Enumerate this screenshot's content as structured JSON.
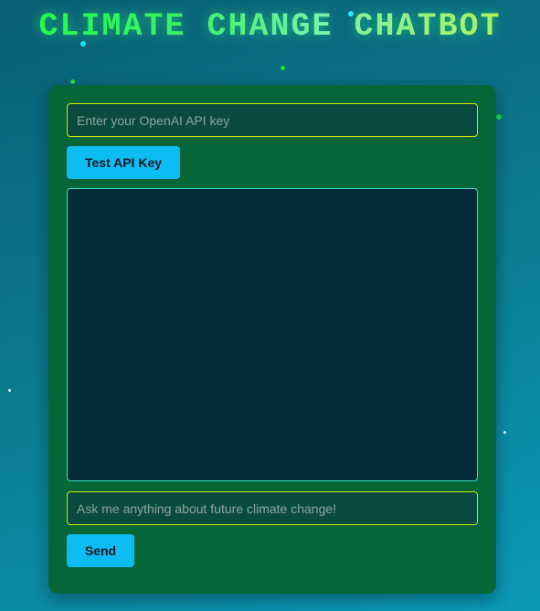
{
  "header": {
    "title": "CLIMATE CHANGE CHATBOT"
  },
  "api_key": {
    "placeholder": "Enter your OpenAI API key",
    "value": "",
    "test_button_label": "Test API Key"
  },
  "chat": {
    "messages": []
  },
  "message_input": {
    "placeholder": "Ask me anything about future climate change!",
    "value": "",
    "send_button_label": "Send"
  },
  "colors": {
    "panel_background": "#066637",
    "button_accent": "#0dbcf3",
    "input_border": "#d6e60a",
    "chat_border": "#3fe0c8",
    "chat_background": "#022b38"
  }
}
